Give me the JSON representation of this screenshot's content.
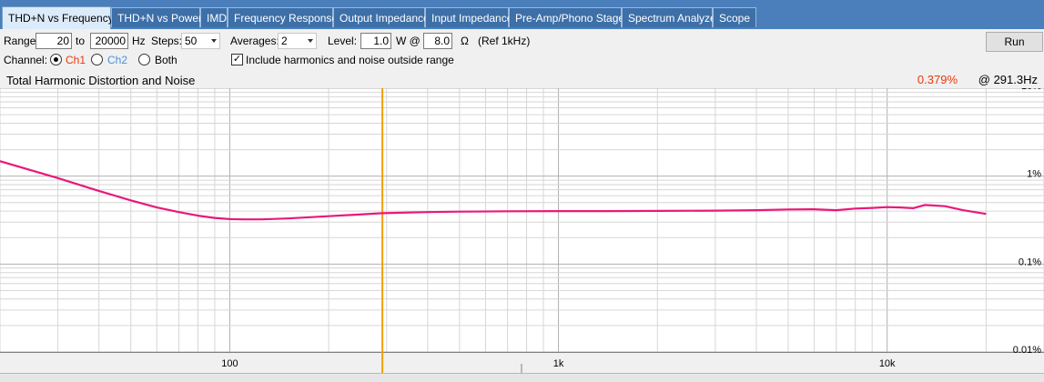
{
  "tabs": [
    {
      "label": "THD+N vs Frequency",
      "active": true
    },
    {
      "label": "THD+N vs Power"
    },
    {
      "label": "IMD"
    },
    {
      "label": "Frequency Response"
    },
    {
      "label": "Output Impedance"
    },
    {
      "label": "Input Impedance"
    },
    {
      "label": "Pre-Amp/Phono Stage"
    },
    {
      "label": "Spectrum Analyzer"
    },
    {
      "label": "Scope"
    }
  ],
  "controls": {
    "range_label": "Range:",
    "range_from": "20",
    "to_label": "to",
    "range_to": "20000",
    "hz_label": "Hz",
    "steps_label": "Steps:",
    "steps_value": "50",
    "averages_label": "Averages:",
    "averages_value": "2",
    "level_label": "Level:",
    "level_value": "1.0",
    "w_at_label": "W @",
    "impedance_value": "8.0",
    "ohm_label": "Ω",
    "ref_label": "(Ref 1kHz)",
    "channel_label": "Channel:",
    "ch1_label": "Ch1",
    "ch2_label": "Ch2",
    "both_label": "Both",
    "include_label": "Include harmonics and noise outside range",
    "run_label": "Run"
  },
  "colors": {
    "ch1": "#e8380d",
    "ch2": "#4a90d9",
    "series": "#e8197a",
    "cursor": "#f0a000",
    "readout": "#e8380d"
  },
  "chart_data": {
    "type": "line",
    "title": "Total Harmonic Distortion and Noise",
    "readout_value": "0.379%",
    "readout_freq": "@ 291.3Hz",
    "xscale": "log",
    "yscale": "log",
    "xlim": [
      20,
      30000
    ],
    "ylim": [
      0.01,
      10
    ],
    "x_ticks": [
      {
        "v": 100,
        "label": "100"
      },
      {
        "v": 1000,
        "label": "1k"
      },
      {
        "v": 10000,
        "label": "10k"
      }
    ],
    "y_ticks": [
      {
        "v": 10,
        "label": "10%"
      },
      {
        "v": 1,
        "label": "1%"
      },
      {
        "v": 0.1,
        "label": "0.1%"
      },
      {
        "v": 0.01,
        "label": "0.01%"
      }
    ],
    "cursor_x": 291.3,
    "grid": true,
    "series": [
      {
        "x": [
          20,
          30,
          40,
          50,
          60,
          70,
          80,
          90,
          100,
          110,
          125,
          150,
          200,
          291.3,
          400,
          500,
          700,
          1000,
          1400,
          2000,
          3000,
          4000,
          5000,
          6000,
          7000,
          8000,
          9000,
          10000,
          11000,
          12000,
          13000,
          15000,
          17000,
          20000
        ],
        "y": [
          1.48,
          0.95,
          0.68,
          0.53,
          0.44,
          0.39,
          0.355,
          0.335,
          0.325,
          0.322,
          0.322,
          0.33,
          0.35,
          0.379,
          0.39,
          0.395,
          0.398,
          0.4,
          0.4,
          0.402,
          0.405,
          0.41,
          0.418,
          0.42,
          0.41,
          0.428,
          0.435,
          0.445,
          0.44,
          0.432,
          0.47,
          0.455,
          0.41,
          0.372
        ]
      }
    ]
  }
}
